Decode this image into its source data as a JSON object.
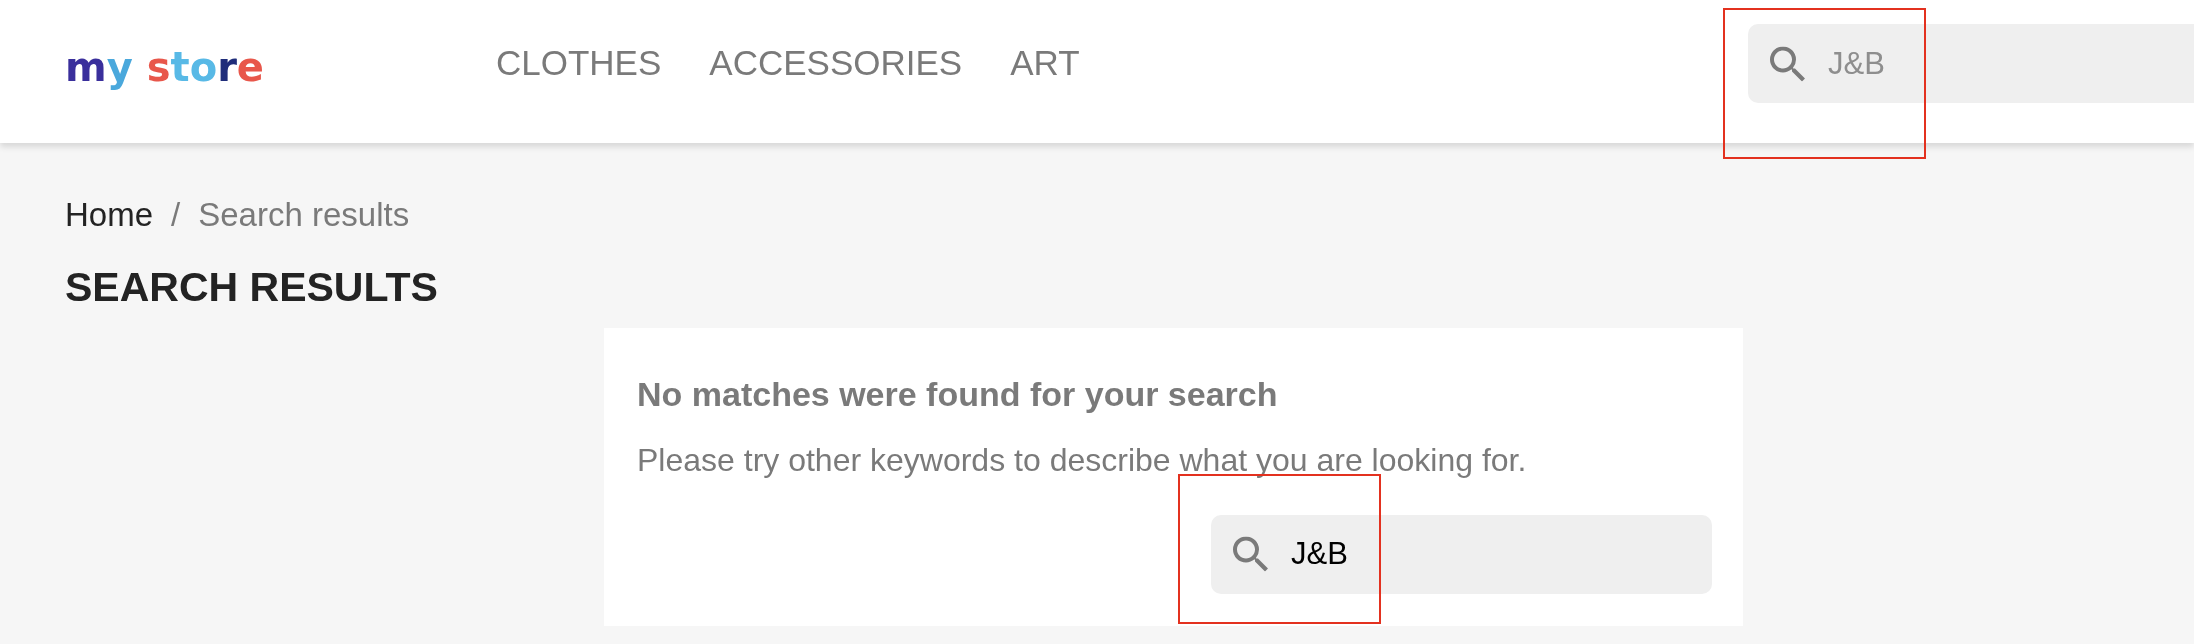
{
  "header": {
    "logo": "my store",
    "nav": [
      "CLOTHES",
      "ACCESSORIES",
      "ART"
    ],
    "search": {
      "placeholder": "J&B"
    }
  },
  "breadcrumb": {
    "separator": "/",
    "items": [
      {
        "label": "Home",
        "current": false
      },
      {
        "label": "Search results",
        "current": true
      }
    ]
  },
  "page_title": "SEARCH RESULTS",
  "results": {
    "heading": "No matches were found for your search",
    "message": "Please try other keywords to describe what you are looking for.",
    "search": {
      "value": "J&B"
    }
  }
}
